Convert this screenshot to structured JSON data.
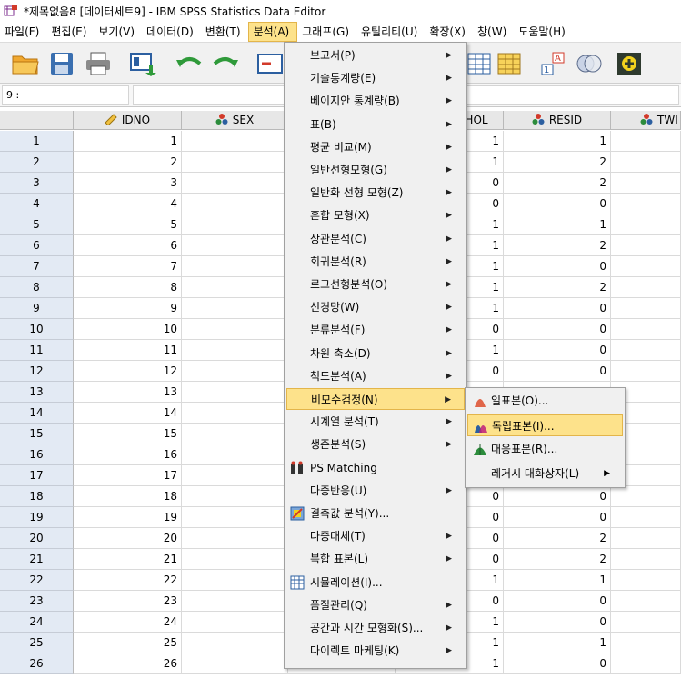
{
  "window": {
    "title": "*제목없음8 [데이터세트9] - IBM SPSS Statistics Data Editor"
  },
  "menubar": [
    {
      "label": "파일(F)"
    },
    {
      "label": "편집(E)"
    },
    {
      "label": "보기(V)"
    },
    {
      "label": "데이터(D)"
    },
    {
      "label": "변환(T)"
    },
    {
      "label": "분석(A)"
    },
    {
      "label": "그래프(G)"
    },
    {
      "label": "유틸리티(U)"
    },
    {
      "label": "확장(X)"
    },
    {
      "label": "창(W)"
    },
    {
      "label": "도움말(H)"
    }
  ],
  "cell_editor": {
    "ref": "9 :",
    "value": ""
  },
  "columns": [
    {
      "label": "IDNO",
      "icon": "ruler-icon"
    },
    {
      "label": "SEX",
      "icon": "nominal-icon"
    },
    {
      "label": "",
      "icon": ""
    },
    {
      "label": "HOL",
      "icon": ""
    },
    {
      "label": "RESID",
      "icon": "nominal-icon"
    },
    {
      "label": "TWI",
      "icon": "nominal-icon"
    }
  ],
  "rows": [
    {
      "n": "1",
      "idno": "1",
      "hol": "1",
      "resid": "1"
    },
    {
      "n": "2",
      "idno": "2",
      "hol": "1",
      "resid": "2"
    },
    {
      "n": "3",
      "idno": "3",
      "hol": "0",
      "resid": "2"
    },
    {
      "n": "4",
      "idno": "4",
      "hol": "0",
      "resid": "0"
    },
    {
      "n": "5",
      "idno": "5",
      "hol": "1",
      "resid": "1"
    },
    {
      "n": "6",
      "idno": "6",
      "hol": "1",
      "resid": "2"
    },
    {
      "n": "7",
      "idno": "7",
      "hol": "1",
      "resid": "0"
    },
    {
      "n": "8",
      "idno": "8",
      "hol": "1",
      "resid": "2"
    },
    {
      "n": "9",
      "idno": "9",
      "hol": "1",
      "resid": "0"
    },
    {
      "n": "10",
      "idno": "10",
      "hol": "0",
      "resid": "0"
    },
    {
      "n": "11",
      "idno": "11",
      "hol": "1",
      "resid": "0"
    },
    {
      "n": "12",
      "idno": "12",
      "hol": "0",
      "resid": "0"
    },
    {
      "n": "13",
      "idno": "13",
      "hol": "",
      "resid": ""
    },
    {
      "n": "14",
      "idno": "14",
      "hol": "",
      "resid": ""
    },
    {
      "n": "15",
      "idno": "15",
      "hol": "",
      "resid": ""
    },
    {
      "n": "16",
      "idno": "16",
      "hol": "",
      "resid": ""
    },
    {
      "n": "17",
      "idno": "17",
      "hol": "",
      "resid": ""
    },
    {
      "n": "18",
      "idno": "18",
      "hol": "0",
      "resid": "0"
    },
    {
      "n": "19",
      "idno": "19",
      "hol": "0",
      "resid": "0"
    },
    {
      "n": "20",
      "idno": "20",
      "hol": "0",
      "resid": "2"
    },
    {
      "n": "21",
      "idno": "21",
      "hol": "0",
      "resid": "2"
    },
    {
      "n": "22",
      "idno": "22",
      "hol": "1",
      "resid": "1"
    },
    {
      "n": "23",
      "idno": "23",
      "hol": "0",
      "resid": "0"
    },
    {
      "n": "24",
      "idno": "24",
      "hol": "1",
      "resid": "0"
    },
    {
      "n": "25",
      "idno": "25",
      "hol": "1",
      "resid": "1"
    },
    {
      "n": "26",
      "idno": "26",
      "hol": "1",
      "resid": "0"
    }
  ],
  "analysis_menu": [
    {
      "label": "보고서(P)",
      "submenu": true
    },
    {
      "label": "기술통계량(E)",
      "submenu": true
    },
    {
      "label": "베이지안 통계량(B)",
      "submenu": true
    },
    {
      "label": "표(B)",
      "submenu": true
    },
    {
      "label": "평균 비교(M)",
      "submenu": true
    },
    {
      "label": "일반선형모형(G)",
      "submenu": true
    },
    {
      "label": "일반화 선형 모형(Z)",
      "submenu": true
    },
    {
      "label": "혼합 모형(X)",
      "submenu": true
    },
    {
      "label": "상관분석(C)",
      "submenu": true
    },
    {
      "label": "회귀분석(R)",
      "submenu": true
    },
    {
      "label": "로그선형분석(O)",
      "submenu": true
    },
    {
      "label": "신경망(W)",
      "submenu": true
    },
    {
      "label": "분류분석(F)",
      "submenu": true
    },
    {
      "label": "차원 축소(D)",
      "submenu": true
    },
    {
      "label": "척도분석(A)",
      "submenu": true
    },
    {
      "label": "비모수검정(N)",
      "submenu": true,
      "highlight": true
    },
    {
      "label": "시계열 분석(T)",
      "submenu": true
    },
    {
      "label": "생존분석(S)",
      "submenu": true
    },
    {
      "label": "PS Matching",
      "submenu": false,
      "icon": "ps-matching-icon"
    },
    {
      "label": "다중반응(U)",
      "submenu": true
    },
    {
      "label": "결측값 분석(Y)...",
      "submenu": false,
      "icon": "missing-value-icon"
    },
    {
      "label": "다중대체(T)",
      "submenu": true
    },
    {
      "label": "복합 표본(L)",
      "submenu": true
    },
    {
      "label": "시뮬레이션(I)...",
      "submenu": false,
      "icon": "simulation-icon"
    },
    {
      "label": "품질관리(Q)",
      "submenu": true
    },
    {
      "label": "공간과 시간 모형화(S)...",
      "submenu": true
    },
    {
      "label": "다이렉트 마케팅(K)",
      "submenu": true
    }
  ],
  "nonparam_submenu": [
    {
      "label": "일표본(O)...",
      "icon": "one-sample-icon",
      "color": "#e0664a"
    },
    {
      "label": "독립표본(I)...",
      "icon": "independent-samples-icon",
      "color": "#c0207a",
      "highlight": true
    },
    {
      "label": "대응표본(R)...",
      "icon": "related-samples-icon",
      "color": "#2c8c3c"
    },
    {
      "label": "레거시 대화상자(L)",
      "submenu": true
    }
  ],
  "colors": {
    "menu_highlight": "#fde28b",
    "row_header": "#e3eaf4",
    "menu_bg": "#f0f0f0"
  }
}
